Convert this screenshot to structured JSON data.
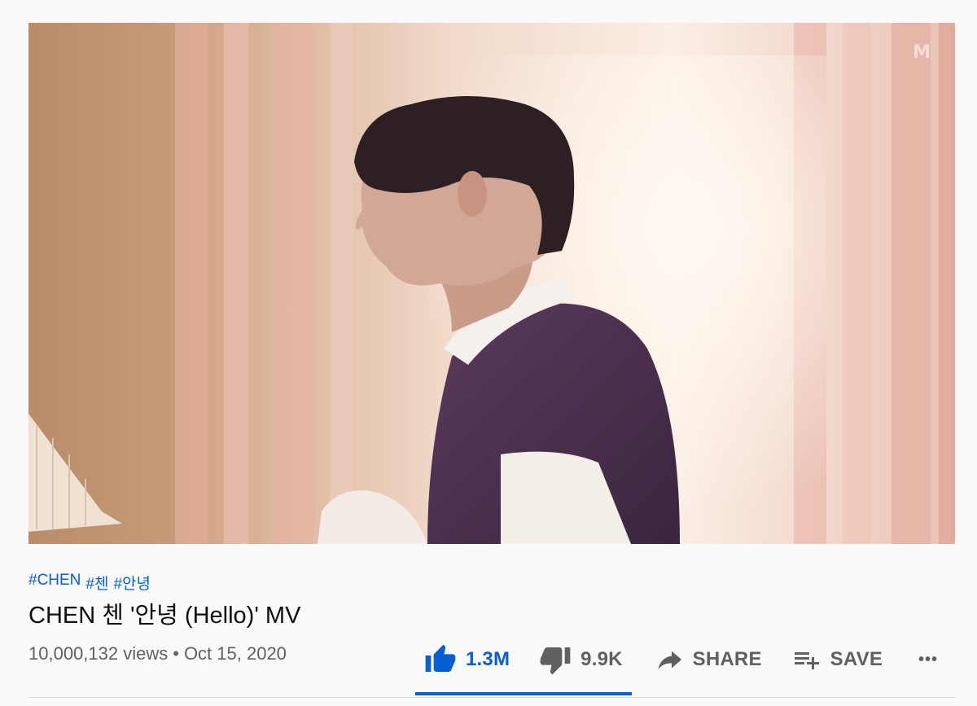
{
  "video": {
    "watermark": "M",
    "hashtags": [
      "#CHEN",
      "#첸",
      "#안녕"
    ],
    "title": "CHEN 첸 '안녕 (Hello)' MV",
    "views": "10,000,132 views",
    "separator": "•",
    "date": "Oct 15, 2020"
  },
  "actions": {
    "like_count": "1.3M",
    "dislike_count": "9.9K",
    "share_label": "SHARE",
    "save_label": "SAVE",
    "more_label": "•••",
    "like_ratio": 0.992
  },
  "colors": {
    "accent": "#065fd4",
    "secondary_text": "#606060",
    "title_text": "#0f0f0f",
    "background": "#f9f9f9"
  },
  "icons": [
    "thumbs-up-icon",
    "thumbs-down-icon",
    "share-arrow-icon",
    "playlist-add-icon",
    "more-icon"
  ]
}
